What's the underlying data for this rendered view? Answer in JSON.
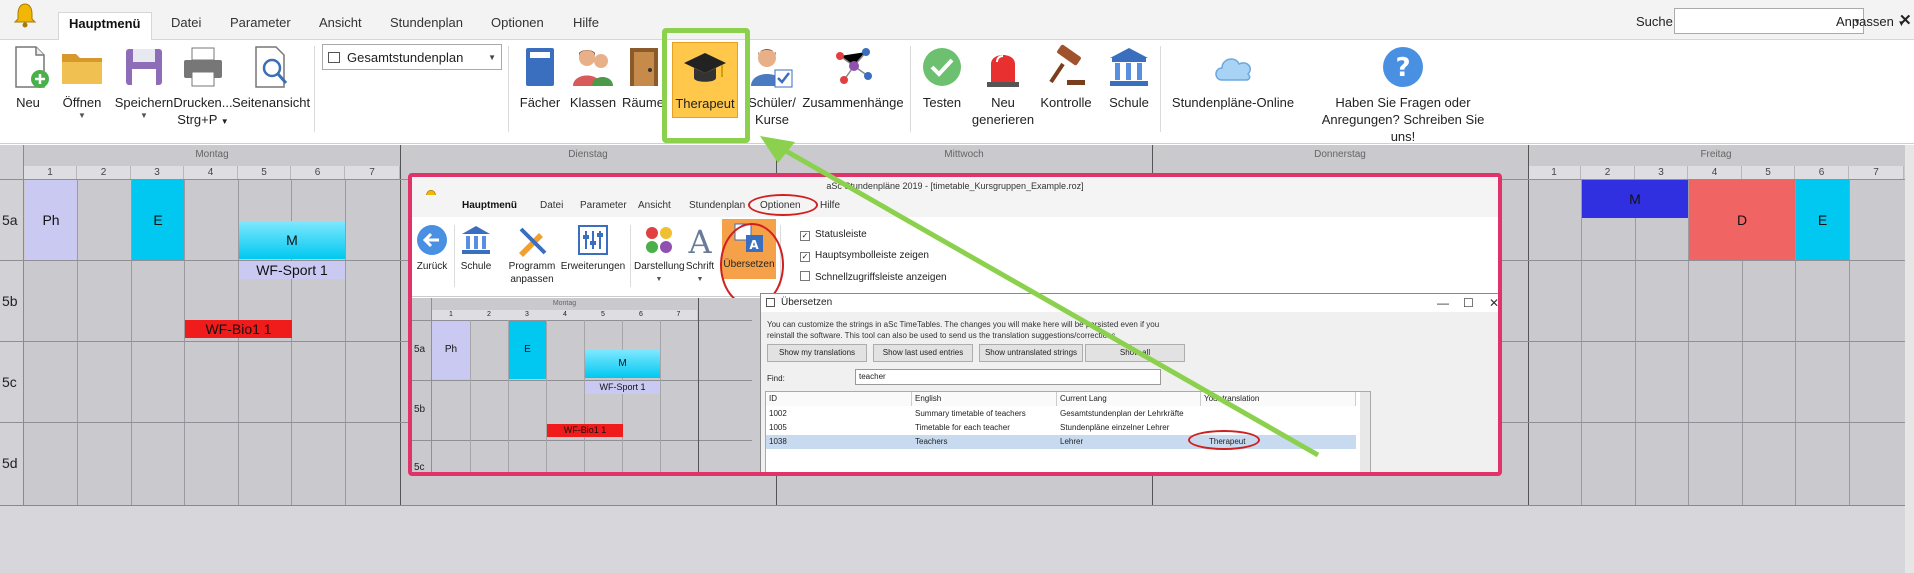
{
  "menubar": {
    "tabs": [
      "Hauptmenü",
      "Datei",
      "Parameter",
      "Ansicht",
      "Stundenplan",
      "Optionen",
      "Hilfe"
    ],
    "search_label": "Suche:",
    "search_value": "",
    "customize_label": "Anpassen"
  },
  "ribbon": {
    "new": "Neu",
    "open": "Öffnen",
    "save": "Speichern",
    "print": "Drucken...",
    "print_shortcut": "Strg+P",
    "preview": "Seitenansicht",
    "view_combo": "Gesamtstundenplan",
    "subjects": "Fächer",
    "classes": "Klassen",
    "rooms": "Räume",
    "teacher": "Therapeut",
    "students_line1": "Schüler/",
    "students_line2": "Kurse",
    "relations": "Zusammenhänge",
    "test": "Testen",
    "regenerate_line1": "Neu",
    "regenerate_line2": "generieren",
    "control": "Kontrolle",
    "school": "Schule",
    "online": "Stundenpläne-Online",
    "question_line1": "Haben Sie Fragen oder",
    "question_line2": "Anregungen? Schreiben Sie uns!"
  },
  "timetable": {
    "days": [
      "Montag",
      "Dienstag",
      "Mittwoch",
      "Donnerstag",
      "Freitag"
    ],
    "periods": [
      "1",
      "2",
      "3",
      "4",
      "5",
      "6",
      "7"
    ],
    "rows": [
      "5a",
      "5b",
      "5c",
      "5d"
    ],
    "lessons": {
      "ph": "Ph",
      "e": "E",
      "m": "M",
      "wf_sport": "WF-Sport 1",
      "wf_bio": "WF-Bio1 1",
      "fri_m": "M",
      "fri_d": "D",
      "fri_e": "E"
    }
  },
  "embedded": {
    "window_title": "aSc Stundenpläne 2019  - [timetable_Kursgruppen_Example.roz]",
    "tabs": [
      "Hauptmenü",
      "Datei",
      "Parameter",
      "Ansicht",
      "Stundenplan",
      "Optionen",
      "Hilfe"
    ],
    "back": "Zurück",
    "school": "Schule",
    "customize_line1": "Programm",
    "customize_line2": "anpassen",
    "extensions": "Erweiterungen",
    "display": "Darstellung",
    "font": "Schrift",
    "translate": "Übersetzen",
    "checkboxes": [
      {
        "label": "Statusleiste",
        "checked": true
      },
      {
        "label": "Hauptsymbolleiste zeigen",
        "checked": true
      },
      {
        "label": "Schnellzugriffsleiste anzeigen",
        "checked": false
      }
    ],
    "grid_day": "Montag",
    "grid_periods": [
      "1",
      "2",
      "3",
      "4",
      "5",
      "6",
      "7"
    ],
    "grid_rows": [
      "5a",
      "5b",
      "5c"
    ],
    "grid_lessons": {
      "ph": "Ph",
      "e": "E",
      "m": "M",
      "wf_sport": "WF-Sport 1",
      "wf_bio": "WF-Bio1 1"
    }
  },
  "dialog": {
    "title": "Übersetzen",
    "description": "You can customize the strings in aSc TimeTables. The changes you will make here will be persisted even if you reinstall the software. This tool can also be used to send us the translation suggestions/corrections.",
    "buttons": [
      "Show my translations",
      "Show last used entries",
      "Show untranslated strings",
      "Show all"
    ],
    "find_label": "Find:",
    "find_value": "teacher",
    "columns": [
      "ID",
      "English",
      "Current Lang",
      "Your translation"
    ],
    "rows": [
      {
        "id": "1002",
        "english": "Summary timetable of teachers",
        "current": "Gesamtstundenplan der Lehrkräfte",
        "yours": ""
      },
      {
        "id": "1005",
        "english": "Timetable for each teacher",
        "current": "Stundenpläne einzelner Lehrer",
        "yours": ""
      },
      {
        "id": "1038",
        "english": "Teachers",
        "current": "Lehrer",
        "yours": "Therapeut"
      }
    ]
  },
  "colors": {
    "highlight_green": "#8cd14e",
    "annotation_pink": "#e0336a",
    "annotation_red": "#d02020",
    "lesson_lavender": "#c9c9f2",
    "lesson_cyan": "#00c8f0",
    "lesson_red": "#f01c1c",
    "lesson_blue": "#3030e0",
    "lesson_salmon": "#f06464"
  }
}
